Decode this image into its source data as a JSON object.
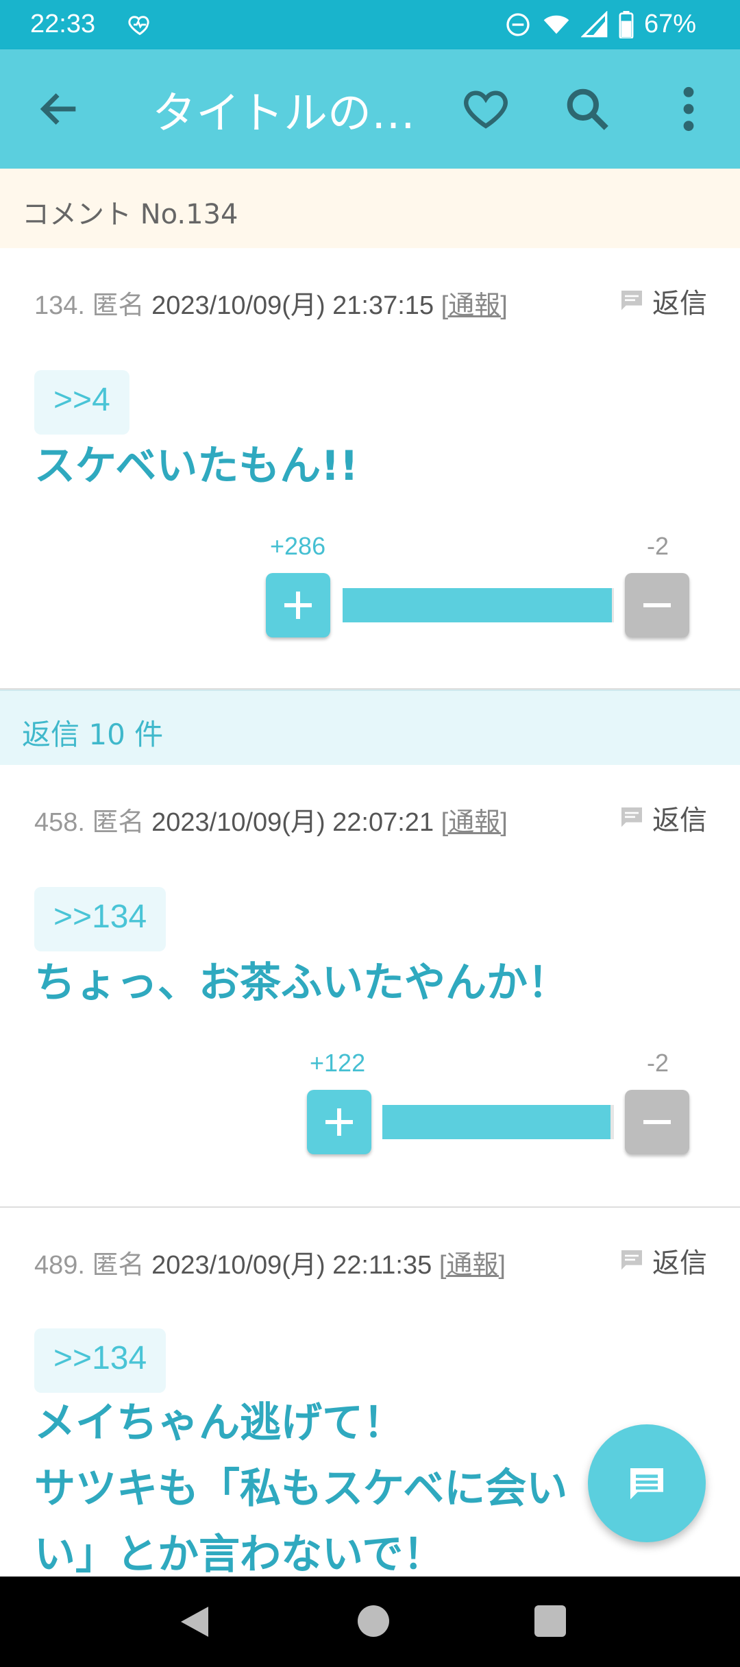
{
  "status_bar": {
    "time": "22:33",
    "battery": "67%"
  },
  "app_bar": {
    "title": "タイトルの一…"
  },
  "comment_header": "コメント No.134",
  "posts": [
    {
      "number": "134.",
      "author": "匿名",
      "date": "2023/10/09(月) 21:37:15",
      "report": "[通報]",
      "reply_label": "返信",
      "anchor": ">>4",
      "lines": [
        "スケベいたもん!!"
      ],
      "plus": "+286",
      "minus": "-2",
      "plus_ratio": 0.993
    },
    {
      "number": "458.",
      "author": "匿名",
      "date": "2023/10/09(月) 22:07:21",
      "report": "[通報]",
      "reply_label": "返信",
      "anchor": ">>134",
      "lines": [
        "ちょっ、お茶ふいたやんか！"
      ],
      "plus": "+122",
      "minus": "-2",
      "plus_ratio": 0.984
    },
    {
      "number": "489.",
      "author": "匿名",
      "date": "2023/10/09(月) 22:11:35",
      "report": "[通報]",
      "reply_label": "返信",
      "anchor": ">>134",
      "lines": [
        "メイちゃん逃げて！",
        "サツキも「私もスケベに会い",
        "い」とか言わないで！"
      ]
    }
  ],
  "replies_strip": "返信 10 件"
}
